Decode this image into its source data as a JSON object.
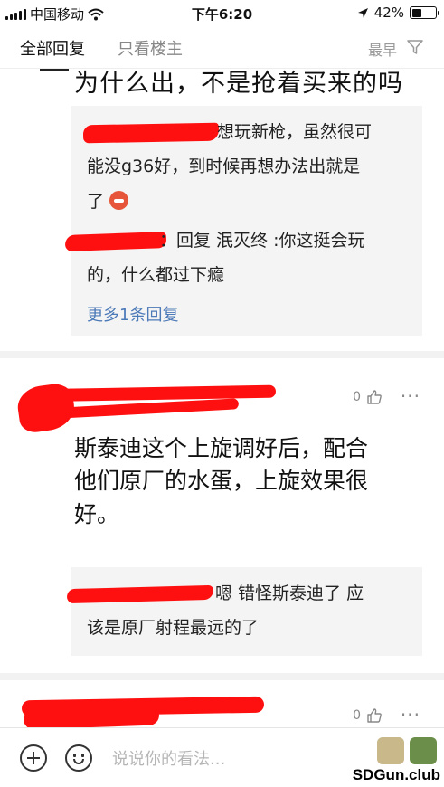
{
  "status_bar": {
    "carrier": "中国移动",
    "time": "下午6:20",
    "battery": "42%",
    "battery_level": 0.42,
    "icons": [
      "signal-icon",
      "wifi-icon",
      "location-arrow-icon",
      "battery-icon"
    ]
  },
  "tabs": {
    "all": "全部回复",
    "op_only": "只看楼主",
    "sort": "最早",
    "filter_icon": "funnel-icon"
  },
  "thread": {
    "continued_text": "为什么出，不是抢着买来的吗",
    "replies_1": {
      "r1_line1": "想玩新枪，虽然很可",
      "r1_line2": "能没g36好，到时候再想办法出就是",
      "r1_line3": "了",
      "r1_emoji": "angry-face-icon",
      "r2_line1": "：回复 泯灭终 :你这挺会玩",
      "r2_line2": "的，什么都过下瘾",
      "more": "更多1条回复"
    },
    "post_2": {
      "likes": "0",
      "more_icon": "···",
      "body_line1": "斯泰迪这个上旋调好后，配合",
      "body_line2": "他们原厂的水蛋，上旋效果很",
      "body_line3": "好。",
      "reply_line1": "嗯 错怪斯泰迪了 应",
      "reply_line2": "该是原厂射程最远的了"
    },
    "post_3": {
      "likes": "0",
      "more_icon": "···"
    }
  },
  "bottom_bar": {
    "placeholder": "说说你的看法...",
    "watermark": "SDGun.club"
  },
  "colors": {
    "redaction": "#ff1010",
    "link": "#4d7ab8",
    "reply_bg": "#f4f4f4"
  }
}
